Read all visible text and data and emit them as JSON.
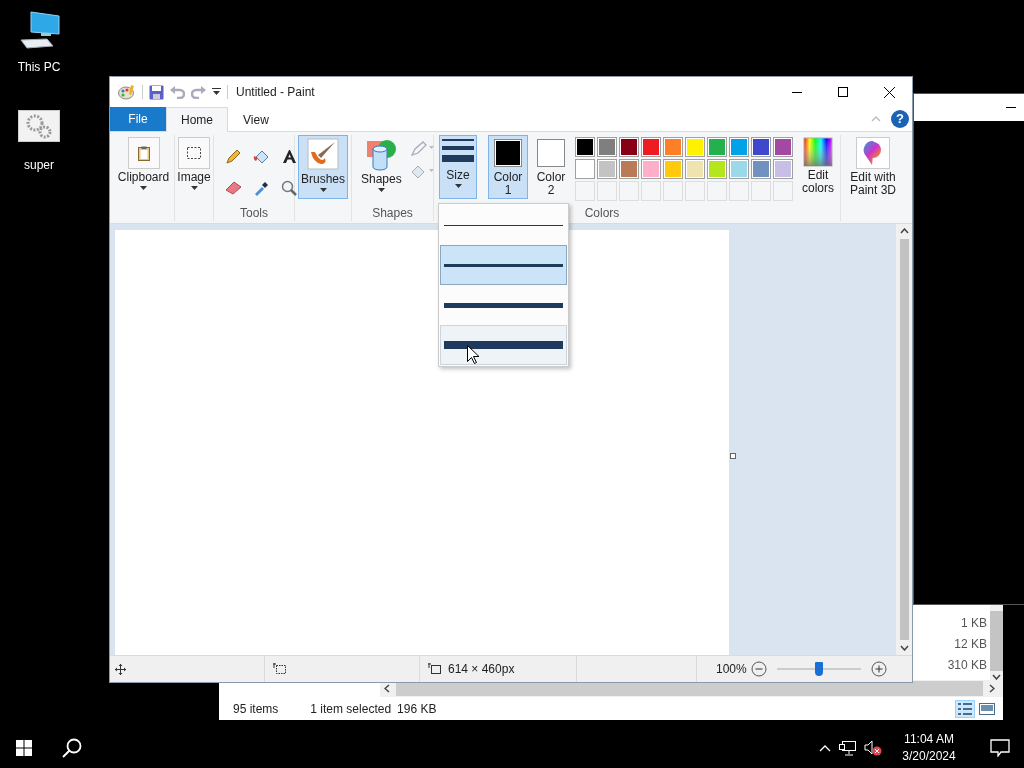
{
  "desktop_icons": [
    {
      "label": "This PC",
      "kind": "computer"
    },
    {
      "label": "super",
      "kind": "gears"
    }
  ],
  "explorer": {
    "file_sizes": [
      "1 KB",
      "12 KB",
      "310 KB"
    ],
    "status_bar": {
      "item_count": "95 items",
      "selection": "1 item selected",
      "selection_size": "196 KB"
    },
    "views": [
      {
        "kind": "details",
        "selected": true
      },
      {
        "kind": "large_icons",
        "selected": false
      }
    ]
  },
  "paint": {
    "title": "Untitled - Paint",
    "tabs": [
      {
        "label": "File",
        "kind": "menu",
        "selected": false
      },
      {
        "label": "Home",
        "kind": "tab",
        "selected": true
      },
      {
        "label": "View",
        "kind": "tab",
        "selected": false
      }
    ],
    "help": {
      "label": "?"
    },
    "ribbon": {
      "clipboard": {
        "label": "Clipboard"
      },
      "image": {
        "label": "Image"
      },
      "tools_group": "Tools",
      "brushes": {
        "label": "Brushes",
        "selected": true
      },
      "shapes": {
        "label": "Shapes"
      },
      "shapes_group": "Shapes",
      "size": {
        "label": "Size",
        "selected": true
      },
      "colors": [
        {
          "label": "Color 1",
          "color": "#000000",
          "selected": true
        },
        {
          "label": "Color 2",
          "color": "#ffffff",
          "selected": false
        }
      ],
      "palette": [
        {
          "color": "#000000"
        },
        {
          "color": "#7f7f7f"
        },
        {
          "color": "#880015"
        },
        {
          "color": "#ed1c24"
        },
        {
          "color": "#ff7f27"
        },
        {
          "color": "#fff200"
        },
        {
          "color": "#22b14c"
        },
        {
          "color": "#00a2e8"
        },
        {
          "color": "#3f48cc"
        },
        {
          "color": "#a349a4"
        },
        {
          "color": "#ffffff"
        },
        {
          "color": "#c3c3c3"
        },
        {
          "color": "#b97a57"
        },
        {
          "color": "#ffaec9"
        },
        {
          "color": "#ffc90e"
        },
        {
          "color": "#efe4b0"
        },
        {
          "color": "#b5e61d"
        },
        {
          "color": "#99d9ea"
        },
        {
          "color": "#7092be"
        },
        {
          "color": "#c8bfe7"
        }
      ],
      "edit_colors": {
        "label": "Edit colors"
      },
      "colors_group": "Colors",
      "paint_3d": {
        "label": "Edit with Paint 3D"
      }
    },
    "size_menu": [
      {
        "selected": false,
        "hovered": false
      },
      {
        "selected": true,
        "hovered": false
      },
      {
        "selected": false,
        "hovered": false
      },
      {
        "selected": false,
        "hovered": true
      }
    ],
    "status_bar": {
      "canvas_size": "614 × 460px",
      "zoom": "100%",
      "zoom_slider": {
        "level": 0.5
      }
    }
  },
  "taskbar": {
    "time": "11:04 AM",
    "date": "3/20/2024",
    "volume_muted": true
  }
}
